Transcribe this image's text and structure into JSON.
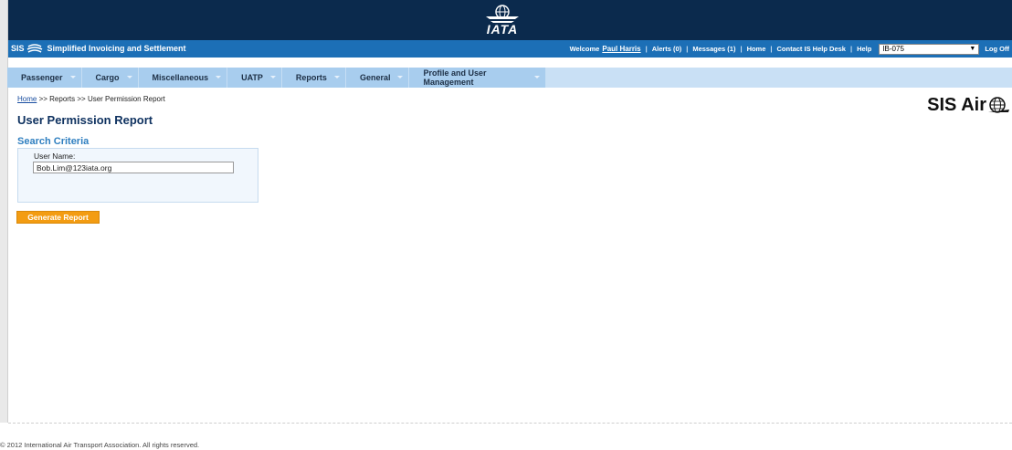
{
  "header": {
    "logo_text": "IATA"
  },
  "sis_bar": {
    "brand": "SIS",
    "subtitle": "Simplified Invoicing and Settlement",
    "welcome_label": "Welcome",
    "user_name": "Paul Harris",
    "alerts": "Alerts (0)",
    "messages": "Messages (1)",
    "home": "Home",
    "contact": "Contact IS Help Desk",
    "help": "Help",
    "member_code": "IB-075",
    "logoff": "Log Off"
  },
  "menu": {
    "items": [
      {
        "label": "Passenger"
      },
      {
        "label": "Cargo"
      },
      {
        "label": "Miscellaneous"
      },
      {
        "label": "UATP"
      },
      {
        "label": "Reports"
      },
      {
        "label": "General"
      },
      {
        "label": "Profile and User Management"
      }
    ]
  },
  "breadcrumb": {
    "home": "Home",
    "rest": ">> Reports >> User Permission Report"
  },
  "page": {
    "title": "User Permission Report",
    "section_title": "Search Criteria",
    "user_name_label": "User Name:",
    "user_name_value": "Bob.Lim@123iata.org",
    "generate_button": "Generate Report"
  },
  "brand_logo": {
    "text": "SIS Air"
  },
  "footer": {
    "copyright": "© 2012 International Air Transport Association. All rights reserved."
  },
  "colors": {
    "header_bg": "#0b2a4d",
    "sis_bar_bg": "#1c6fb6",
    "menu_bg": "#a8cdee",
    "button_bg": "#f39c12",
    "title_color": "#0f3260"
  }
}
